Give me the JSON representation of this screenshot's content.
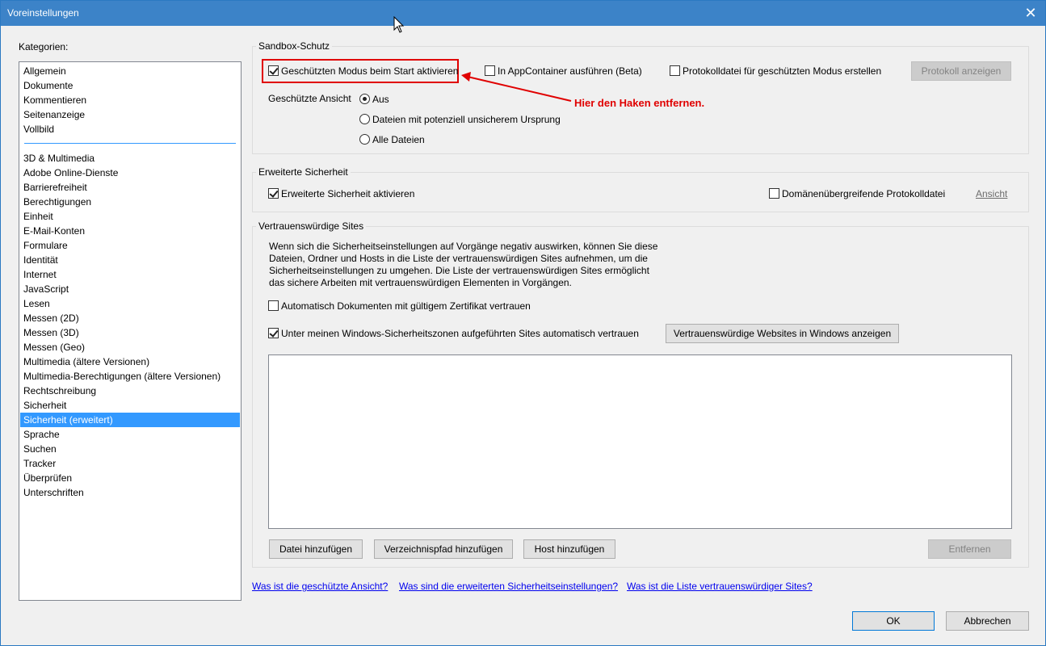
{
  "window": {
    "title": "Voreinstellungen"
  },
  "categories": {
    "label": "Kategorien:",
    "group1": [
      "Allgemein",
      "Dokumente",
      "Kommentieren",
      "Seitenanzeige",
      "Vollbild"
    ],
    "group2": [
      "3D & Multimedia",
      "Adobe Online-Dienste",
      "Barrierefreiheit",
      "Berechtigungen",
      "Einheit",
      "E-Mail-Konten",
      "Formulare",
      "Identität",
      "Internet",
      "JavaScript",
      "Lesen",
      "Messen (2D)",
      "Messen (3D)",
      "Messen (Geo)",
      "Multimedia (ältere Versionen)",
      "Multimedia-Berechtigungen (ältere Versionen)",
      "Rechtschreibung",
      "Sicherheit",
      "Sicherheit (erweitert)",
      "Sprache",
      "Suchen",
      "Tracker",
      "Überprüfen",
      "Unterschriften"
    ],
    "selected": "Sicherheit (erweitert)"
  },
  "sandbox": {
    "title": "Sandbox-Schutz",
    "protected_mode": {
      "label": "Geschützten Modus beim Start aktivieren",
      "checked": true
    },
    "appcontainer": {
      "label": "In AppContainer ausführen (Beta)",
      "checked": false
    },
    "logfile": {
      "label": "Protokolldatei für geschützten Modus erstellen",
      "checked": false
    },
    "view_log_button": "Protokoll anzeigen",
    "protected_view_label": "Geschützte Ansicht",
    "radio_options": [
      "Aus",
      "Dateien mit potenziell unsicherem Ursprung",
      "Alle Dateien"
    ],
    "radio_selected": "Aus"
  },
  "annotation": {
    "text": "Hier den Haken entfernen.",
    "color": "#e00000"
  },
  "enhanced": {
    "title": "Erweiterte Sicherheit",
    "enable": {
      "label": "Erweiterte Sicherheit aktivieren",
      "checked": true
    },
    "crossdomain": {
      "label": "Domänenübergreifende Protokolldatei",
      "checked": false
    },
    "view_link": "Ansicht"
  },
  "trusted": {
    "title": "Vertrauenswürdige Sites",
    "description": "Wenn sich die Sicherheitseinstellungen auf Vorgänge negativ auswirken,  können Sie diese Dateien, Ordner und Hosts in die Liste der vertrauenswürdigen Sites aufnehmen, um die Sicherheitseinstellungen zu umgehen. Die Liste der vertrauenswürdigen Sites ermöglicht das sichere Arbeiten mit vertrauenswürdigen Elementen in Vorgängen.",
    "auto_cert": {
      "label": "Automatisch Dokumenten mit gültigem Zertifikat vertrauen",
      "checked": false
    },
    "windows_zones": {
      "label": "Unter meinen Windows-Sicherheitszonen aufgeführten Sites automatisch vertrauen",
      "checked": true
    },
    "show_windows_sites_button": "Vertrauenswürdige Websites in Windows anzeigen",
    "add_file_button": "Datei hinzufügen",
    "add_folder_button": "Verzeichnispfad hinzufügen",
    "add_host_button": "Host hinzufügen",
    "remove_button": "Entfernen"
  },
  "links": {
    "protected_view": "Was ist die geschützte Ansicht?",
    "enhanced_settings": "Was sind die erweiterten Sicherheitseinstellungen?",
    "trusted_list": "Was ist die Liste vertrauenswürdiger Sites?"
  },
  "footer": {
    "ok": "OK",
    "cancel": "Abbrechen"
  },
  "colors": {
    "titlebar": "#3c83c8",
    "selection": "#3399ff",
    "link": "#0000ee",
    "highlight": "#e00000"
  }
}
